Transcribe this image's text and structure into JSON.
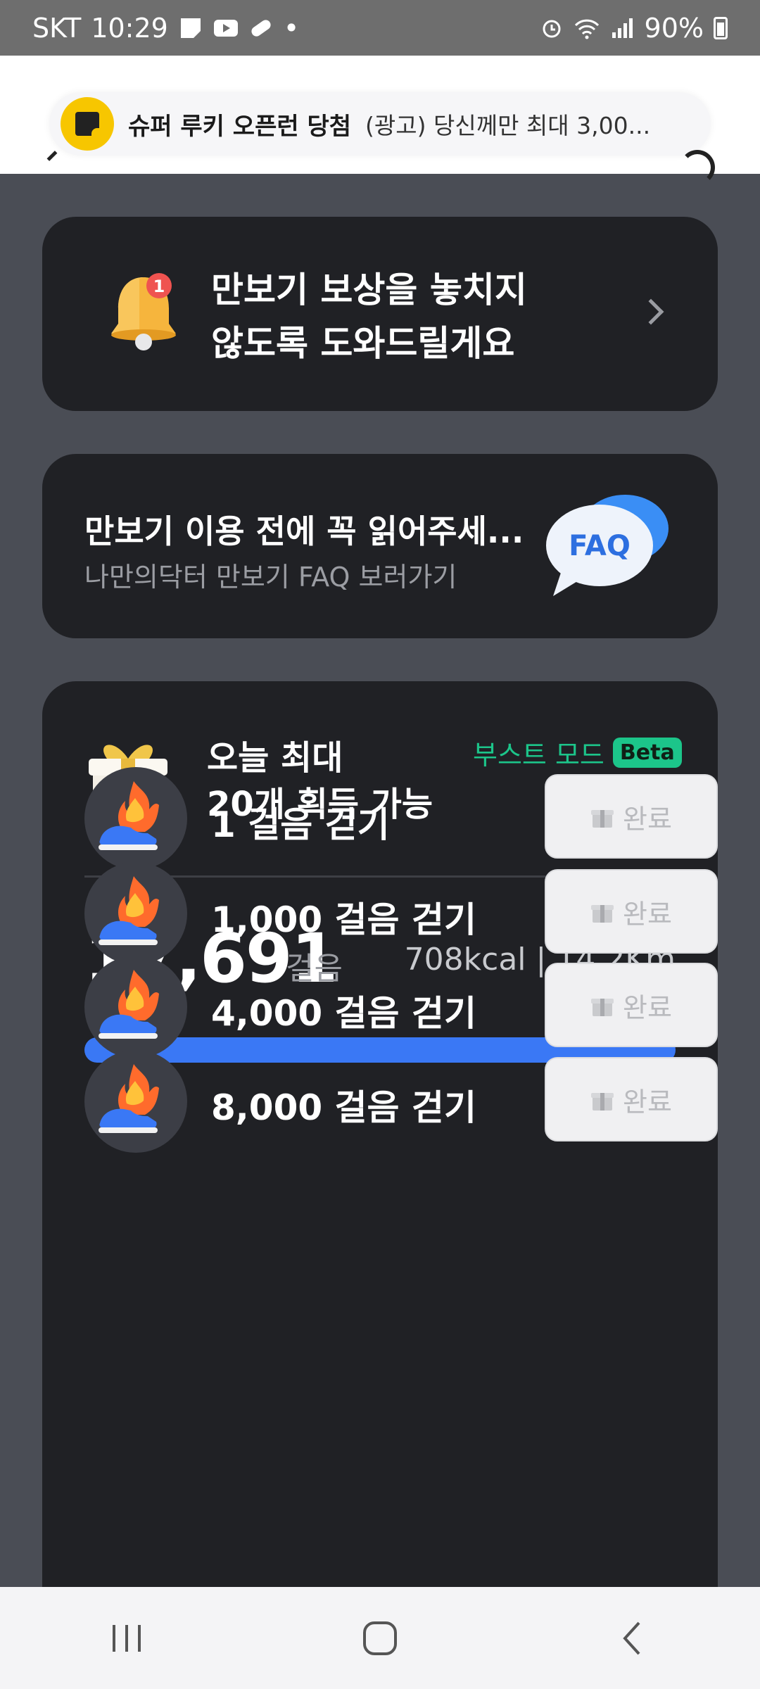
{
  "status_bar": {
    "carrier": "SKT",
    "time": "10:29",
    "battery": "90%"
  },
  "ad": {
    "brand": "슈퍼 루키 오픈런 당첨",
    "text": "(광고) 당신께만 최대 3,00..."
  },
  "notification_card": {
    "badge": "1",
    "line1": "만보기 보상을 놓치지",
    "line2": "않도록 도와드릴게요"
  },
  "faq_card": {
    "title": "만보기 이용 전에 꼭 읽어주세...",
    "subtitle": "나만의닥터 만보기 FAQ 보러가기",
    "icon_text": "FAQ"
  },
  "reward_card": {
    "gift_badge": "20",
    "title_line1": "오늘 최대",
    "title_line2": "20개 획득 가능",
    "boost_label": "부스트 모드",
    "beta_label": "Beta",
    "boost_enabled": true,
    "steps": "17,691",
    "steps_unit": "걸음",
    "meta": "708kcal | 14.2Km",
    "progress_percent": 100,
    "missions": [
      {
        "label": "1 걸음 걷기",
        "button": "완료"
      },
      {
        "label": "1,000 걸음 걷기",
        "button": "완료"
      },
      {
        "label": "4,000 걸음 걷기",
        "button": "완료"
      },
      {
        "label": "8,000 걸음 걷기",
        "button": "완료"
      }
    ]
  },
  "colors": {
    "accent_blue": "#3a78f5",
    "boost_green": "#1cc58a",
    "card_bg": "#202125",
    "page_bg": "#4a4d55"
  },
  "icons": [
    "bell-icon",
    "chevron-right-icon",
    "faq-bubble-icon",
    "gift-box-icon",
    "running-shoe-icon",
    "recents-icon",
    "home-icon",
    "back-icon"
  ]
}
